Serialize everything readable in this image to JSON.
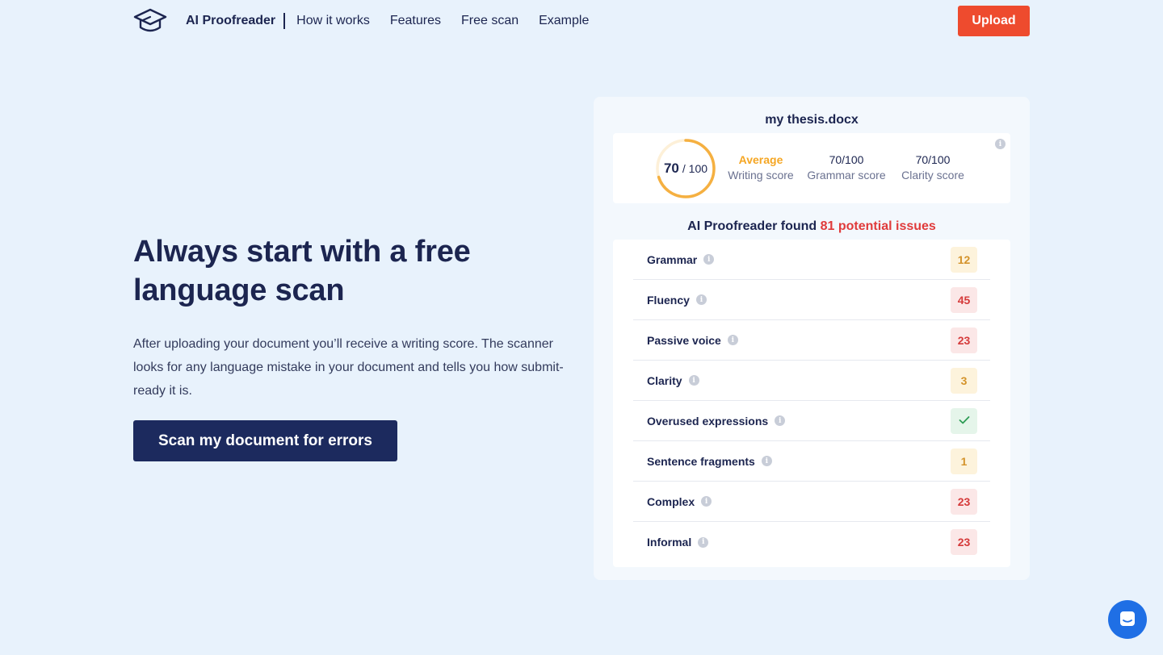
{
  "header": {
    "brand": "AI Proofreader",
    "nav": [
      "How it works",
      "Features",
      "Free scan",
      "Example"
    ],
    "upload_label": "Upload"
  },
  "hero": {
    "title": "Always start with a free language scan",
    "description": "After uploading your document you’ll receive a writing score. The scanner looks for any language mistake in your document and tells you how submit-ready it is.",
    "cta_label": "Scan my document for errors"
  },
  "report": {
    "document_name": "my thesis.docx",
    "score": {
      "value": "70",
      "max_label": "/ 100",
      "progress": 0.7,
      "ring_color": "#f5b041"
    },
    "metrics": [
      {
        "value": "Average",
        "label": "Writing score"
      },
      {
        "value": "70/100",
        "label": "Grammar score"
      },
      {
        "value": "70/100",
        "label": "Clarity score"
      }
    ],
    "found_prefix": "AI Proofreader found",
    "found_count": "81 potential issues",
    "issues": [
      {
        "name": "Grammar",
        "value": "12",
        "status": "yellow"
      },
      {
        "name": "Fluency",
        "value": "45",
        "status": "red"
      },
      {
        "name": "Passive voice",
        "value": "23",
        "status": "red"
      },
      {
        "name": "Clarity",
        "value": "3",
        "status": "yellow"
      },
      {
        "name": "Overused expressions",
        "value": "",
        "status": "green",
        "icon": "check-icon"
      },
      {
        "name": "Sentence fragments",
        "value": "1",
        "status": "yellow"
      },
      {
        "name": "Complex",
        "value": "23",
        "status": "red"
      },
      {
        "name": "Informal",
        "value": "23",
        "status": "red"
      }
    ]
  },
  "colors": {
    "accent": "#ee4b2e",
    "navy": "#1c2a5e",
    "background": "#e8f2fc",
    "chat": "#1f6fe5"
  }
}
